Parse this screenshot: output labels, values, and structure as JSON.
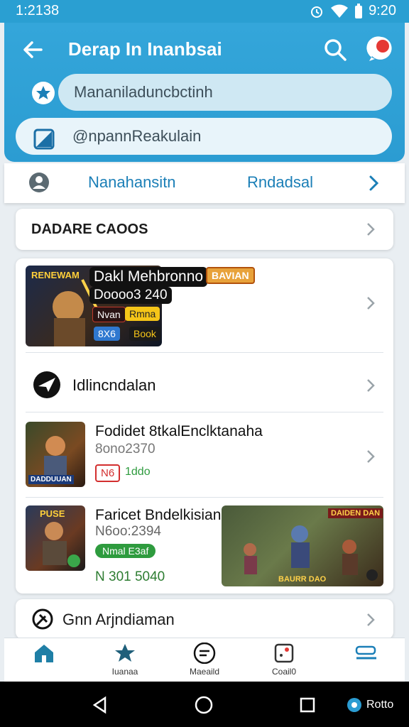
{
  "status_bar": {
    "time": "1:2138",
    "clock_right": "9:20"
  },
  "header": {
    "title": "Derap In Inanbsai"
  },
  "fields": {
    "search_value": "Mananiladuncbctinh",
    "second_value": "@npannReakulain"
  },
  "tabs": {
    "tab1": "Nanahansitn",
    "tab2": "Rndadsal"
  },
  "section": {
    "heading": "DADARE CAOOS"
  },
  "items": [
    {
      "title": "Dakl Mehbronno",
      "subtitle": "Doooo3 240",
      "tag": "BAVIAN",
      "thumb_text": "RENEWAM",
      "badges": [
        "Nvan",
        "Rmna",
        "8X6",
        "Book"
      ]
    },
    {
      "title": "Idlincndalan"
    },
    {
      "title": "Fodidet 8tkalEnclktanaha",
      "subtitle": "8ono2370",
      "thumb_text": "DADDUUAN",
      "badges": [
        "N6",
        "1ddo"
      ]
    },
    {
      "title": "Faricet Bndelkisian",
      "subtitle": "N6oo:2394",
      "price": "N 301 5040",
      "thumb_text": "PUSE",
      "badges": [
        "Nmal E3af"
      ],
      "banner_top": "DAIDEN DAN",
      "banner_bottom": "BAURR DAO"
    }
  ],
  "bottom_item": {
    "label": "Gnn Arjndiaman"
  },
  "bottom_nav": [
    {
      "label": ""
    },
    {
      "label": "Iuanaa"
    },
    {
      "label": "Maeaild"
    },
    {
      "label": "Coail0"
    },
    {
      "label": ""
    }
  ],
  "system_nav": {
    "pill_label": "Rotto"
  },
  "colors": {
    "primary": "#2b9cd2",
    "accent": "#1b7fb7",
    "notify": "#e53935"
  }
}
